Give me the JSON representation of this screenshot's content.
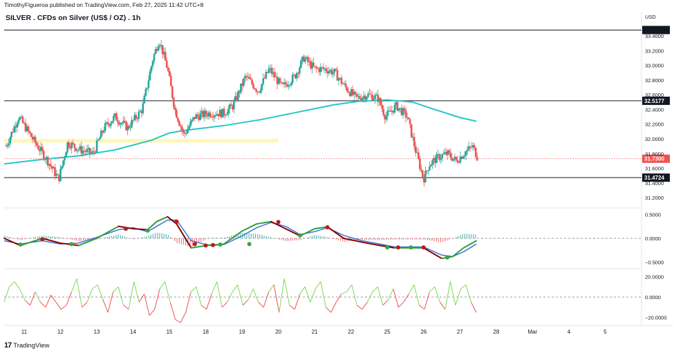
{
  "header": {
    "published": "TimothyFigueroa published on TradingView.com, Feb 27, 2025 11:42 UTC+8",
    "title": "SILVER . CFDs on Silver (US$ / OZ) . 1h",
    "currency": "USD",
    "footer": "TradingView"
  },
  "colors": {
    "up": "#26a69a",
    "down": "#ef5350",
    "ma": "#26c6c6",
    "zone": "#fff6a8",
    "blue": "#3f6fd6",
    "dark_red": "#8b0000",
    "osc_green": "#7ed957",
    "osc_red": "#f05050"
  },
  "chart_data": [
    {
      "type": "candlestick",
      "title": "SILVER . CFDs on Silver (US$ / OZ) . 1h",
      "yaxis": {
        "ticks": [
          31.2,
          31.4,
          31.6,
          31.8,
          32.0,
          32.2,
          32.4,
          32.6,
          32.8,
          33.0,
          33.2,
          33.4
        ],
        "tick_labels": [
          "31.2000",
          "31.4000",
          "31.6000",
          "31.8000",
          "32.0000",
          "32.2000",
          "32.4000",
          "32.6000",
          "32.8000",
          "33.0000",
          "33.2000",
          "33.4000"
        ],
        "range": [
          31.07,
          33.55
        ]
      },
      "xaxis": {
        "ticks": [
          {
            "t": 11,
            "label": "11"
          },
          {
            "t": 12,
            "label": "12"
          },
          {
            "t": 13,
            "label": "13"
          },
          {
            "t": 14,
            "label": "14"
          },
          {
            "t": 15,
            "label": "15"
          },
          {
            "t": 16,
            "label": "18"
          },
          {
            "t": 17,
            "label": "19"
          },
          {
            "t": 18,
            "label": "20"
          },
          {
            "t": 19,
            "label": "21"
          },
          {
            "t": 20,
            "label": "22"
          },
          {
            "t": 21,
            "label": "25"
          },
          {
            "t": 22,
            "label": "26"
          },
          {
            "t": 23,
            "label": "27"
          },
          {
            "t": 24,
            "label": "28"
          },
          {
            "t": 25,
            "label": "Mar"
          },
          {
            "t": 26,
            "label": "4"
          },
          {
            "t": 27,
            "label": "5"
          }
        ],
        "range": [
          10.45,
          28.0
        ]
      },
      "price_levels": [
        {
          "value": 32.5177,
          "label": "32.5177"
        },
        {
          "value": 31.4724,
          "label": "31.4724"
        },
        {
          "value": 33.48,
          "label": ""
        }
      ],
      "current_price": {
        "value": 31.73,
        "label": "31.7300"
      },
      "zone": {
        "x_start": 10.45,
        "x_end": 18.0,
        "y_low": 31.95,
        "y_high": 32.0
      },
      "key_points": [
        {
          "t": 10.5,
          "p": 31.9
        },
        {
          "t": 10.85,
          "p": 32.3
        },
        {
          "t": 11.3,
          "p": 31.95
        },
        {
          "t": 11.65,
          "p": 31.7
        },
        {
          "t": 11.95,
          "p": 31.45
        },
        {
          "t": 12.2,
          "p": 31.95
        },
        {
          "t": 12.55,
          "p": 31.85
        },
        {
          "t": 12.9,
          "p": 31.8
        },
        {
          "t": 13.2,
          "p": 32.15
        },
        {
          "t": 13.5,
          "p": 32.3
        },
        {
          "t": 13.85,
          "p": 32.15
        },
        {
          "t": 14.25,
          "p": 32.4
        },
        {
          "t": 14.55,
          "p": 33.1
        },
        {
          "t": 14.72,
          "p": 33.35
        },
        {
          "t": 14.95,
          "p": 32.95
        },
        {
          "t": 15.15,
          "p": 32.4
        },
        {
          "t": 15.4,
          "p": 32.05
        },
        {
          "t": 15.7,
          "p": 32.3
        },
        {
          "t": 16.1,
          "p": 32.35
        },
        {
          "t": 16.5,
          "p": 32.35
        },
        {
          "t": 16.75,
          "p": 32.45
        },
        {
          "t": 17.1,
          "p": 32.85
        },
        {
          "t": 17.45,
          "p": 32.65
        },
        {
          "t": 17.75,
          "p": 32.95
        },
        {
          "t": 18.1,
          "p": 32.7
        },
        {
          "t": 18.45,
          "p": 32.85
        },
        {
          "t": 18.7,
          "p": 33.1
        },
        {
          "t": 19.0,
          "p": 32.95
        },
        {
          "t": 19.3,
          "p": 32.95
        },
        {
          "t": 19.55,
          "p": 32.9
        },
        {
          "t": 19.85,
          "p": 32.7
        },
        {
          "t": 20.15,
          "p": 32.55
        },
        {
          "t": 20.45,
          "p": 32.6
        },
        {
          "t": 20.75,
          "p": 32.55
        },
        {
          "t": 20.95,
          "p": 32.3
        },
        {
          "t": 21.25,
          "p": 32.45
        },
        {
          "t": 21.55,
          "p": 32.3
        },
        {
          "t": 21.8,
          "p": 31.8
        },
        {
          "t": 22.0,
          "p": 31.45
        },
        {
          "t": 22.15,
          "p": 31.65
        },
        {
          "t": 22.4,
          "p": 31.75
        },
        {
          "t": 22.65,
          "p": 31.8
        },
        {
          "t": 22.9,
          "p": 31.7
        },
        {
          "t": 23.1,
          "p": 31.8
        },
        {
          "t": 23.35,
          "p": 31.9
        },
        {
          "t": 23.5,
          "p": 31.73
        }
      ],
      "ma_line": [
        {
          "t": 10.45,
          "p": 31.66
        },
        {
          "t": 11.5,
          "p": 31.72
        },
        {
          "t": 12.5,
          "p": 31.77
        },
        {
          "t": 13.5,
          "p": 31.85
        },
        {
          "t": 14.5,
          "p": 31.98
        },
        {
          "t": 15.0,
          "p": 32.08
        },
        {
          "t": 15.5,
          "p": 32.12
        },
        {
          "t": 16.5,
          "p": 32.18
        },
        {
          "t": 17.5,
          "p": 32.26
        },
        {
          "t": 18.5,
          "p": 32.36
        },
        {
          "t": 19.5,
          "p": 32.46
        },
        {
          "t": 20.2,
          "p": 32.51
        },
        {
          "t": 21.0,
          "p": 32.53
        },
        {
          "t": 21.7,
          "p": 32.5
        },
        {
          "t": 22.3,
          "p": 32.4
        },
        {
          "t": 23.0,
          "p": 32.29
        },
        {
          "t": 23.45,
          "p": 32.24
        }
      ]
    },
    {
      "type": "line",
      "name": "momentum-oscillator",
      "yaxis": {
        "ticks": [
          0.5,
          0.0,
          -0.5
        ],
        "tick_labels": [
          "0.5000",
          "0.0000",
          "−0.5000"
        ],
        "range": [
          -0.62,
          0.62
        ]
      },
      "fast": [
        {
          "t": 10.45,
          "v": 0.0
        },
        {
          "t": 10.9,
          "v": -0.15
        },
        {
          "t": 11.5,
          "v": 0.0
        },
        {
          "t": 12.0,
          "v": -0.1
        },
        {
          "t": 12.5,
          "v": -0.15
        },
        {
          "t": 13.0,
          "v": 0.0
        },
        {
          "t": 13.6,
          "v": 0.25
        },
        {
          "t": 14.0,
          "v": 0.2
        },
        {
          "t": 14.4,
          "v": 0.18
        },
        {
          "t": 14.65,
          "v": 0.35
        },
        {
          "t": 14.95,
          "v": 0.45
        },
        {
          "t": 15.2,
          "v": 0.3
        },
        {
          "t": 15.6,
          "v": -0.2
        },
        {
          "t": 16.1,
          "v": -0.14
        },
        {
          "t": 16.5,
          "v": -0.12
        },
        {
          "t": 17.0,
          "v": 0.15
        },
        {
          "t": 17.4,
          "v": 0.3
        },
        {
          "t": 17.8,
          "v": 0.35
        },
        {
          "t": 18.2,
          "v": 0.2
        },
        {
          "t": 18.6,
          "v": 0.05
        },
        {
          "t": 19.0,
          "v": 0.2
        },
        {
          "t": 19.35,
          "v": 0.24
        },
        {
          "t": 19.8,
          "v": 0.0
        },
        {
          "t": 20.3,
          "v": -0.08
        },
        {
          "t": 20.8,
          "v": -0.15
        },
        {
          "t": 21.2,
          "v": -0.2
        },
        {
          "t": 21.6,
          "v": -0.2
        },
        {
          "t": 22.0,
          "v": -0.2
        },
        {
          "t": 22.5,
          "v": -0.42
        },
        {
          "t": 22.8,
          "v": -0.38
        },
        {
          "t": 23.1,
          "v": -0.2
        },
        {
          "t": 23.45,
          "v": -0.05
        }
      ],
      "slow": [
        {
          "t": 10.45,
          "v": -0.05
        },
        {
          "t": 10.9,
          "v": -0.12
        },
        {
          "t": 11.5,
          "v": -0.05
        },
        {
          "t": 12.0,
          "v": -0.12
        },
        {
          "t": 12.5,
          "v": -0.1
        },
        {
          "t": 13.0,
          "v": 0.02
        },
        {
          "t": 13.6,
          "v": 0.18
        },
        {
          "t": 14.0,
          "v": 0.22
        },
        {
          "t": 14.4,
          "v": 0.14
        },
        {
          "t": 14.65,
          "v": 0.25
        },
        {
          "t": 14.95,
          "v": 0.38
        },
        {
          "t": 15.2,
          "v": 0.38
        },
        {
          "t": 15.6,
          "v": -0.05
        },
        {
          "t": 16.1,
          "v": -0.15
        },
        {
          "t": 16.5,
          "v": -0.13
        },
        {
          "t": 17.0,
          "v": 0.05
        },
        {
          "t": 17.4,
          "v": 0.22
        },
        {
          "t": 17.8,
          "v": 0.33
        },
        {
          "t": 18.2,
          "v": 0.25
        },
        {
          "t": 18.6,
          "v": 0.08
        },
        {
          "t": 19.0,
          "v": 0.14
        },
        {
          "t": 19.35,
          "v": 0.22
        },
        {
          "t": 19.8,
          "v": 0.06
        },
        {
          "t": 20.3,
          "v": -0.05
        },
        {
          "t": 20.8,
          "v": -0.12
        },
        {
          "t": 21.2,
          "v": -0.18
        },
        {
          "t": 21.6,
          "v": -0.18
        },
        {
          "t": 22.0,
          "v": -0.18
        },
        {
          "t": 22.5,
          "v": -0.35
        },
        {
          "t": 22.8,
          "v": -0.38
        },
        {
          "t": 23.1,
          "v": -0.28
        },
        {
          "t": 23.45,
          "v": -0.12
        }
      ],
      "signals": [
        {
          "t": 10.9,
          "v": -0.13,
          "type": "bull"
        },
        {
          "t": 11.5,
          "v": -0.02,
          "type": "bear"
        },
        {
          "t": 12.3,
          "v": -0.12,
          "type": "bull"
        },
        {
          "t": 13.8,
          "v": 0.2,
          "type": "bear"
        },
        {
          "t": 14.4,
          "v": 0.16,
          "type": "bull"
        },
        {
          "t": 15.2,
          "v": 0.35,
          "type": "bear"
        },
        {
          "t": 15.7,
          "v": -0.12,
          "type": "bear"
        },
        {
          "t": 16.0,
          "v": -0.15,
          "type": "bear"
        },
        {
          "t": 16.2,
          "v": -0.14,
          "type": "bear"
        },
        {
          "t": 16.4,
          "v": -0.13,
          "type": "bull"
        },
        {
          "t": 17.2,
          "v": -0.12,
          "type": "bull"
        },
        {
          "t": 18.0,
          "v": 0.34,
          "type": "bear"
        },
        {
          "t": 18.6,
          "v": 0.06,
          "type": "bull"
        },
        {
          "t": 19.35,
          "v": 0.23,
          "type": "bear"
        },
        {
          "t": 21.0,
          "v": -0.19,
          "type": "bull"
        },
        {
          "t": 21.3,
          "v": -0.19,
          "type": "bear"
        },
        {
          "t": 21.65,
          "v": -0.19,
          "type": "bull"
        },
        {
          "t": 22.0,
          "v": -0.19,
          "type": "bear"
        },
        {
          "t": 22.65,
          "v": -0.4,
          "type": "bull"
        }
      ]
    },
    {
      "type": "line",
      "name": "oscillator-2",
      "yaxis": {
        "ticks": [
          20,
          0,
          -20
        ],
        "tick_labels": [
          "20.0000",
          "0.0000",
          "−20.0000"
        ],
        "range": [
          -27,
          27
        ]
      },
      "values": [
        -5,
        10,
        15,
        8,
        -3,
        -8,
        5,
        -5,
        -10,
        2,
        -5,
        -12,
        -8,
        5,
        18,
        -10,
        -5,
        8,
        12,
        -2,
        -15,
        5,
        10,
        -8,
        -12,
        15,
        -5,
        3,
        -18,
        -12,
        8,
        15,
        -5,
        -22,
        -25,
        -15,
        5,
        10,
        -8,
        -12,
        3,
        15,
        -10,
        -5,
        5,
        12,
        -8,
        -3,
        8,
        -5,
        -10,
        5,
        12,
        -15,
        18,
        -8,
        -12,
        3,
        10,
        -5,
        8,
        15,
        -10,
        -15,
        -5,
        3,
        5,
        12,
        -8,
        -12,
        -5,
        5,
        10,
        -8,
        -3,
        8,
        -10,
        -5,
        3,
        12,
        -8,
        -12,
        5,
        10,
        -5,
        -12,
        15,
        -8,
        8,
        12,
        -5,
        -15
      ]
    }
  ]
}
